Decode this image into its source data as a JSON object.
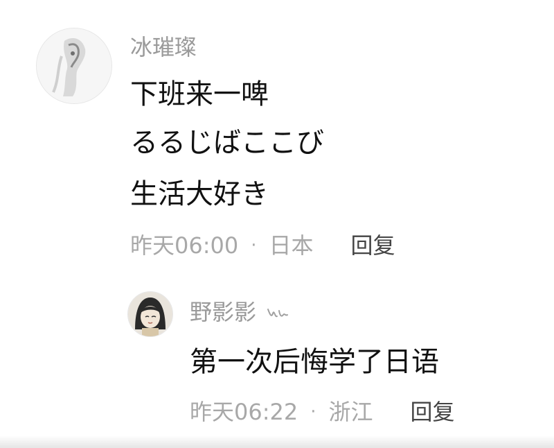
{
  "comments": [
    {
      "username": "冰璀璨",
      "lines": [
        "下班来一啤",
        "るるじばここび",
        "生活大好き"
      ],
      "time": "昨天06:00",
      "separator": "·",
      "location": "日本",
      "reply_label": "回复",
      "replies": [
        {
          "username": "野影影",
          "lines": [
            "第一次后悔学了日语"
          ],
          "time": "昨天06:22",
          "separator": "·",
          "location": "浙江",
          "reply_label": "回复"
        }
      ]
    }
  ]
}
